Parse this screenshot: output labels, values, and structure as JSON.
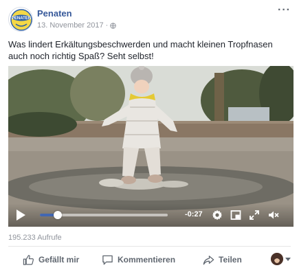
{
  "post": {
    "page_name": "Penaten",
    "timestamp": "13. November 2017",
    "separator": "·",
    "more_label": "···",
    "text": "Was lindert Erkältungsbeschwerden und macht kleinen Tropfnasen auch noch richtig Spaß? Seht selbst!",
    "logo_text": "PENATEN"
  },
  "video": {
    "time_remaining": "-0:27",
    "progress": 0.14
  },
  "stats": {
    "views": "195.233 Aufrufe"
  },
  "actions": {
    "like_label": "Gefällt mir",
    "comment_label": "Kommentieren",
    "share_label": "Teilen"
  },
  "colors": {
    "link": "#365899",
    "progress": "#4267b2",
    "muted": "#90949c"
  }
}
